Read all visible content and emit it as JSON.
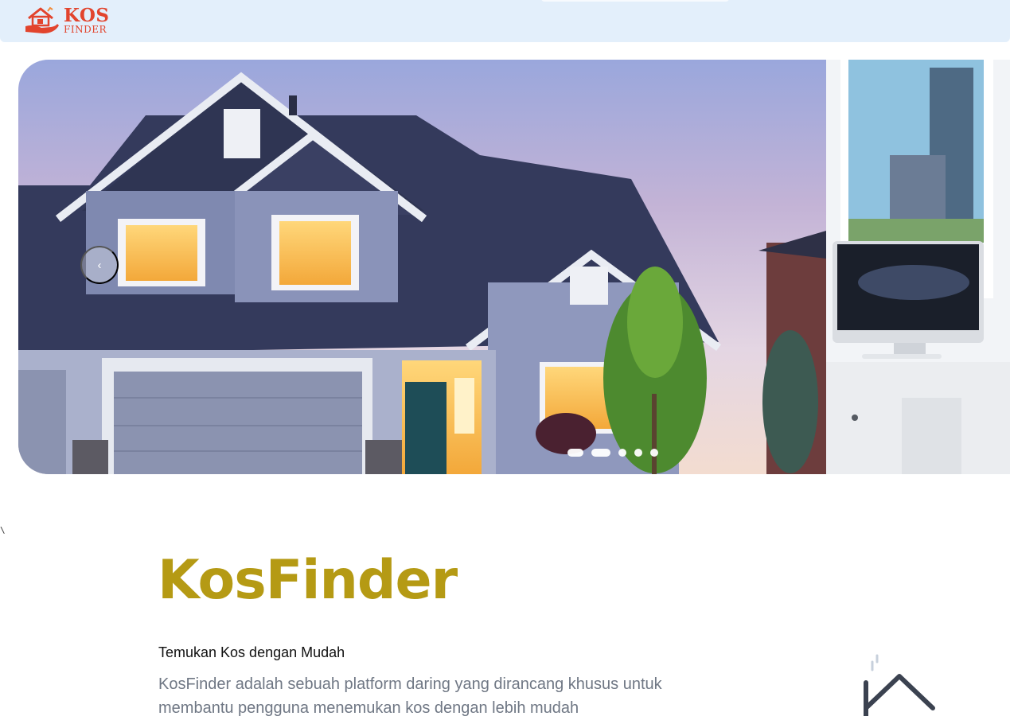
{
  "brand": {
    "logo_line1": "KOS",
    "logo_line2": "FINDER"
  },
  "carousel": {
    "prev_icon": "‹",
    "indicator_count": 5,
    "active_index": 1
  },
  "stray_mark": "\\",
  "hero": {
    "title": "KosFinder",
    "tagline": "Temukan Kos dengan Mudah",
    "description": "KosFinder adalah sebuah platform daring yang dirancang khusus untuk membantu pengguna menemukan kos dengan lebih mudah"
  },
  "colors": {
    "navbar_bg": "#e3effb",
    "brand_red": "#e2442d",
    "title_gold": "#b59a14",
    "body_text": "#6f7784"
  },
  "icons": [
    "house-hand-logo-icon",
    "chevron-left-icon",
    "house-outline-icon"
  ]
}
